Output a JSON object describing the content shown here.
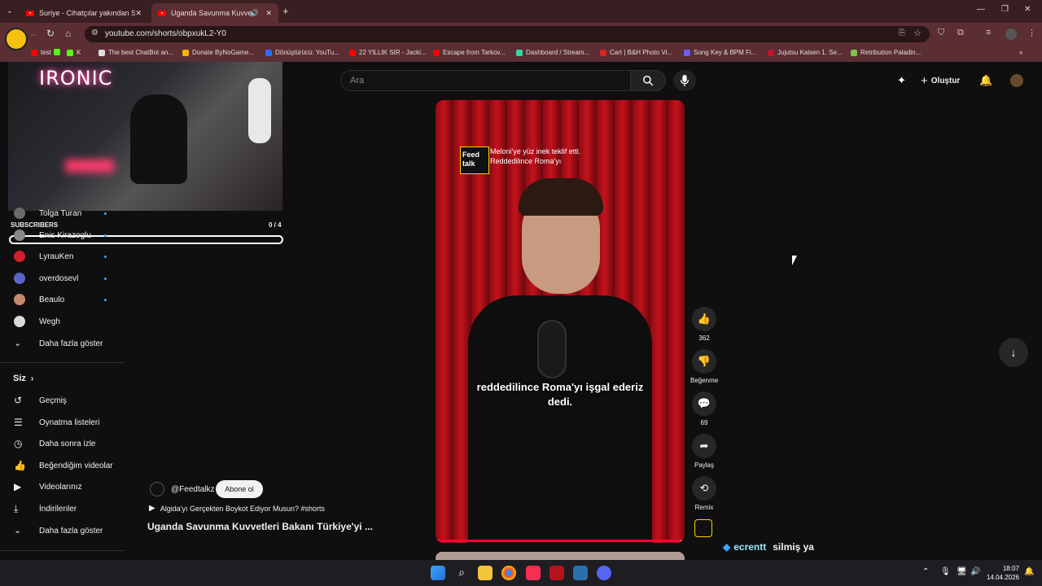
{
  "tabs": [
    {
      "label": "Suriye - Cihatçılar yakından SA"
    },
    {
      "label": "Uganda Savunma Kuvvetler"
    }
  ],
  "address": {
    "url": "youtube.com/shorts/obpxukL2-Y0"
  },
  "bookmarks": [
    {
      "label": "test",
      "color": "#ff0000"
    },
    {
      "label": "K",
      "color": "#53fc18"
    },
    {
      "label": "The best ChatBot an...",
      "color": "#dddddd"
    },
    {
      "label": "Donate ByNoGame...",
      "color": "#f0b400"
    },
    {
      "label": "Dönüştürücü: YouTu...",
      "color": "#2b6cff"
    },
    {
      "label": "22 YILLIK SIR - Jacki...",
      "color": "#ff0000"
    },
    {
      "label": "Escape from Tarkov...",
      "color": "#ff0000"
    },
    {
      "label": "Dashboard / Stream...",
      "color": "#2fd9a0"
    },
    {
      "label": "Cart | B&H Photo Vi...",
      "color": "#d22"
    },
    {
      "label": "Song Key & BPM Fi...",
      "color": "#6a5cff"
    },
    {
      "label": "Jujutsu Kaisen 1. Se...",
      "color": "#c0142b"
    },
    {
      "label": "Retribution Paladin...",
      "color": "#7cc34a"
    }
  ],
  "search": {
    "placeholder": "Ara"
  },
  "header": {
    "create_label": "Oluştur"
  },
  "overlay": {
    "neon_text": "IRONIC"
  },
  "subscribers_widget": {
    "title": "SUBSCRIBERS",
    "count": "0 / 4"
  },
  "sidebar": {
    "subs": [
      {
        "label": "Tolga Turan",
        "color": "#6b6b6b"
      },
      {
        "label": "Enis Kirazoglu",
        "color": "#888888"
      },
      {
        "label": "LyrauKen",
        "color": "#d3202b"
      },
      {
        "label": "overdosevl",
        "color": "#5866c9"
      },
      {
        "label": "Beaulo",
        "color": "#c68a6a"
      },
      {
        "label": "Wegh",
        "color": "#d9d9d9"
      }
    ],
    "show_more": "Daha fazla göster",
    "you_title": "Siz",
    "you_items": [
      {
        "label": "Geçmiş",
        "icon": "history-icon"
      },
      {
        "label": "Oynatma listeleri",
        "icon": "playlists-icon"
      },
      {
        "label": "Daha sonra izle",
        "icon": "watch-later-icon"
      },
      {
        "label": "Beğendiğim videolar",
        "icon": "liked-icon"
      },
      {
        "label": "Videolarınız",
        "icon": "your-videos-icon"
      },
      {
        "label": "İndirilenler",
        "icon": "download-icon"
      },
      {
        "label": "Daha fazla göster",
        "icon": "chevron-down-icon"
      }
    ]
  },
  "short": {
    "channel_handle": "@Feedtalkz",
    "subscribe_label": "Abone ol",
    "playlist_link": "Algida'yı Gerçekten Boykot Ediyor Musun? #shorts",
    "title": "Uganda Savunma Kuvvetleri Bakanı Türkiye'yi ...",
    "logo_text": "Feed talk",
    "headline": "Meloni'ye yüz inek teklif etti. Reddedilince Roma'yı",
    "caption": "reddedilince Roma'yı işgal ederiz dedi.",
    "likes": "362",
    "dislike_label": "Beğenme",
    "comments": "69",
    "share_label": "Paylaş",
    "remix_label": "Remix",
    "progress": 0.98
  },
  "chat_overlay": {
    "username": "ecrentt",
    "message": "silmiş ya"
  },
  "taskbar": {
    "time": "18:07",
    "date": "14.04.2026"
  },
  "colors": {
    "accent": "#3ea6ff",
    "bg": "#0f0f0f",
    "chrome": "#5a2e33"
  }
}
